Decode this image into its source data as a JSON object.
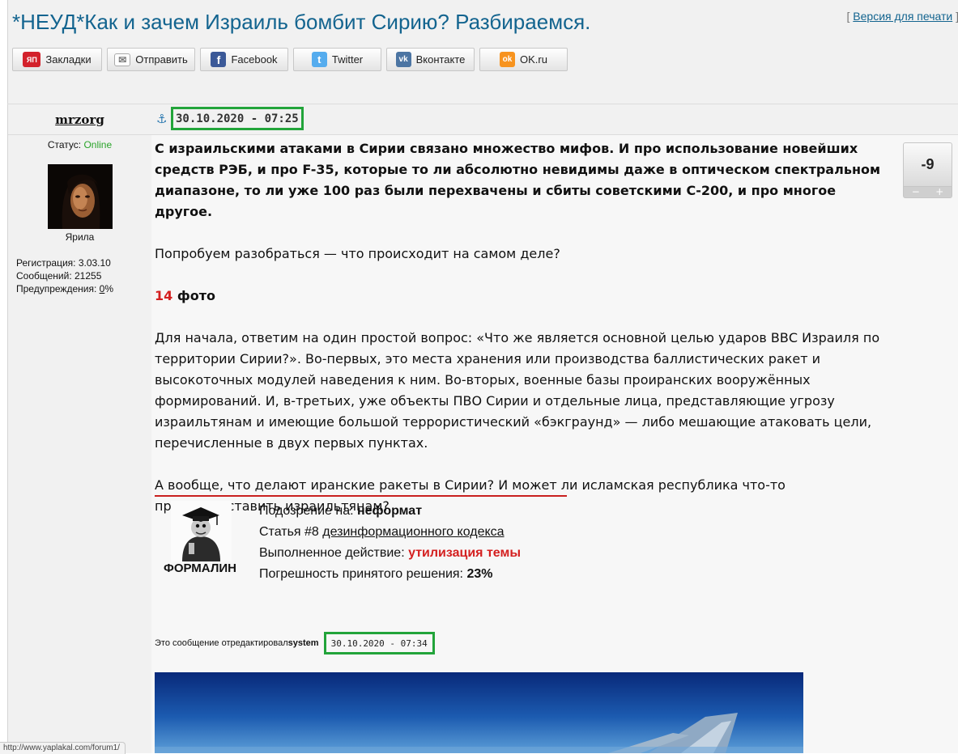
{
  "topic": {
    "title": "*НЕУД*Как и зачем Израиль бомбит Сирию? Разбираемся.",
    "print_left": "[ ",
    "print_label": "Версия для печати",
    "print_right": " ]"
  },
  "share": [
    {
      "label": "Закладки",
      "icon": "yap-bookmarks-icon",
      "icon_text": "ЯП",
      "color": "#d3212b"
    },
    {
      "label": "Отправить",
      "icon": "envelope-icon",
      "icon_text": "✉",
      "color": "#8a8a8a"
    },
    {
      "label": "Facebook",
      "icon": "facebook-icon",
      "icon_text": "f",
      "color": "#3b5998"
    },
    {
      "label": "Twitter",
      "icon": "twitter-icon",
      "icon_text": "t",
      "color": "#55acee"
    },
    {
      "label": "Вконтакте",
      "icon": "vk-icon",
      "icon_text": "vk",
      "color": "#4c75a3"
    },
    {
      "label": "OK.ru",
      "icon": "ok-icon",
      "icon_text": "ok",
      "color": "#f7931e"
    }
  ],
  "author": {
    "nick": "mrzorg",
    "status_label": "Статус: ",
    "status_value": "Online",
    "avatar_name": "Ярила",
    "reg": "Регистрация: 3.03.10",
    "posts": "Сообщений: 21255",
    "warn_label": "Предупреждения: ",
    "warn_value": "0",
    "warn_suffix": "%"
  },
  "post": {
    "date": "30.10.2020 - 07:25",
    "rating": "-9",
    "rating_minus": "−",
    "rating_plus": "+",
    "lead": "С израильскими атаками в Сирии связано множество мифов. И про использование новейших средств РЭБ, и про F-35, которые то ли абсолютно невидимы даже в оптическом спектральном диапазоне, то ли уже 100 раз были перехвачены и сбиты советскими С-200, и про многое другое.",
    "p1": "Попробуем разобраться — что происходит на самом деле?",
    "photos_count": "14",
    "photos_label": " фото",
    "p2": "Для начала, ответим на один простой вопрос: «Что же является основной целью ударов ВВС Израиля по территории Сирии?». Во-первых, это места хранения или производства баллистических ракет и высокоточных модулей наведения к ним. Во-вторых, военные базы проиранских вооружённых формирований. И, в-третьих, уже объекты ПВО Сирии и отдельные лица, представляющие угрозу израильтянам и имеющие большой террористический «бэкграунд» — либо мешающие атаковать цели, перечисленные в двух первых пунктах.",
    "p3": "А вообще, что делают иранские ракеты в Сирии? И может ли исламская республика что-то противопоставить израильтянам?"
  },
  "moderation": {
    "name": "ФОРМАЛИН",
    "l1_label": "Подозрение на: ",
    "l1_value": "неформат",
    "l2_label": "Статья #8 ",
    "l2_link": "дезинформационного кодекса",
    "l3_label": "Выполненное действие: ",
    "l3_value": "утилизация темы",
    "l4_label": "Погрешность принятого решения: ",
    "l4_value": "23%"
  },
  "edited": {
    "text": "Это сообщение отредактировал ",
    "user": "system",
    "date": "30.10.2020 - 07:34"
  },
  "statusbar": {
    "url": "http://www.yaplakal.com/forum1/"
  }
}
